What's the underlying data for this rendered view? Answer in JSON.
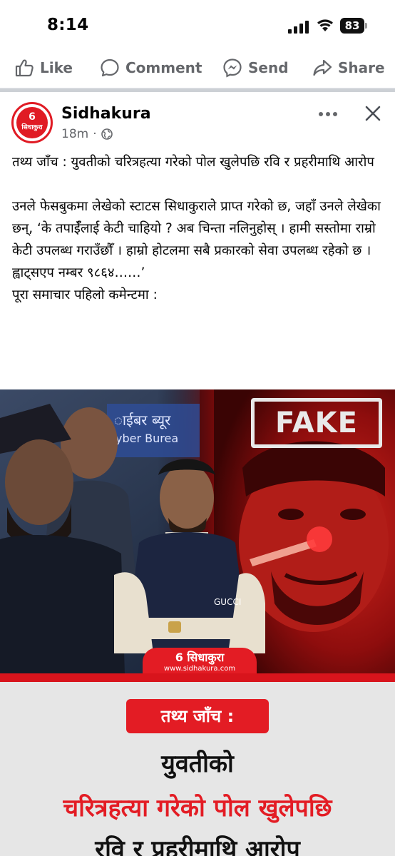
{
  "status_bar": {
    "time": "8:14",
    "battery": "83"
  },
  "actions": {
    "like": "Like",
    "comment": "Comment",
    "send": "Send",
    "share": "Share"
  },
  "post": {
    "page_name": "Sidhakura",
    "avatar_num": "6",
    "avatar_word": "सिधाकुरा",
    "time_ago": "18m",
    "separator": "·",
    "title": "तथ्य जाँच : युवतीको चरित्रहत्या गरेको पोल खुलेपछि रवि र प्रहरीमाथि आरोप",
    "body_1": "उनले फेसबुकमा लेखेको स्टाटस सिधाकुराले प्राप्त गरेको छ, जहाँ उनले लेखेका छन्, ‘के तपाईँलाई केटी चाहियो ? अब चिन्ता नलिनुहोस् । हामी सस्तोमा राम्रो केटी उपलब्ध गराउँछौँ । हाम्रो होटलमा सबै प्रकारको सेवा उपलब्ध रहेको छ । ह्वाट्सएप नम्बर ९८६४……’",
    "body_2": "पूरा समाचार पहिलाे कमेन्टमा :"
  },
  "image": {
    "stamp": "FAKE",
    "sign_text_1": "ाईबर ब्यूर",
    "sign_text_2": "yber Burea",
    "jacket_brand": "GUCCI",
    "logo_brand": "6 सिधाकुरा",
    "logo_site": "www.sidhakura.com",
    "fact_label": "तथ्य जाँच :",
    "headline_1": "युवतीको",
    "headline_2": "चरित्रहत्या गरेको पोल खुलेपछि",
    "headline_3": "रवि र प्रहरीमाथि आरोप"
  },
  "colors": {
    "brand_red": "#e31c24",
    "meta_gray": "#65676b",
    "panel_gray": "#e6e6e6"
  }
}
